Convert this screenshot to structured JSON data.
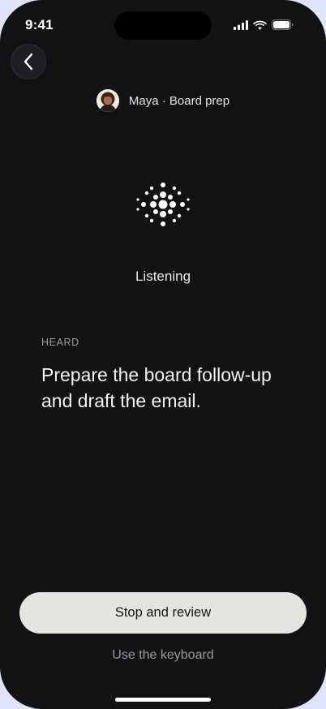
{
  "status_bar": {
    "time": "9:41",
    "icons": [
      "cellular-signal-icon",
      "wifi-icon",
      "battery-icon"
    ]
  },
  "header": {
    "back_icon": "chevron-left-icon",
    "session_label": "Maya · Board prep"
  },
  "voice": {
    "state_label": "Listening"
  },
  "transcript": {
    "label": "HEARD",
    "text": "Prepare the board follow-up and draft the email."
  },
  "actions": {
    "primary_label": "Stop and review",
    "secondary_label": "Use the keyboard"
  },
  "colors": {
    "background": "#111214",
    "primary_button": "#e6e4df",
    "muted_text": "#9a9a9d"
  }
}
